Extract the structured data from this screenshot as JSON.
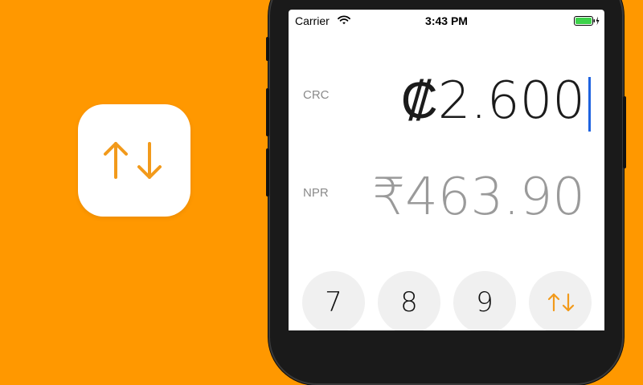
{
  "status_bar": {
    "carrier": "Carrier",
    "time": "3:43 PM"
  },
  "converter": {
    "from_code": "CRC",
    "from_amount": "₡2.600",
    "to_code": "NPR",
    "to_amount": "₹463.90"
  },
  "keypad": {
    "keys": [
      "7",
      "8",
      "9"
    ],
    "swap_icon": "swap-arrows-icon"
  },
  "colors": {
    "background": "#FF9800",
    "accent": "#F29A1B",
    "cursor": "#1E63E0",
    "key_bg": "#F0F0F0"
  }
}
